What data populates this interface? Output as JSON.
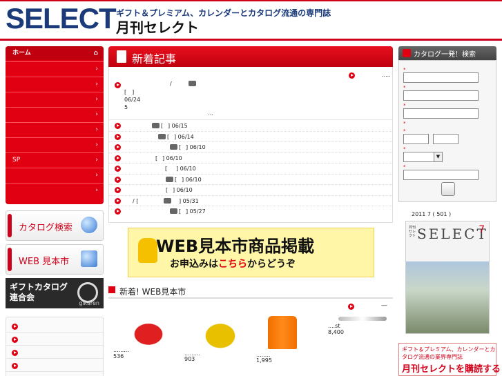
{
  "header": {
    "logo": "SELECT",
    "tagline": "ギフト＆プレミアム、カレンダーとカタログ流通の専門誌",
    "subtitle": "月刊セレクト"
  },
  "nav": {
    "home": "ホーム",
    "sp_label": "SP",
    "chevron": "›"
  },
  "side_banners": {
    "catalog_search": "カタログ検索",
    "web_market": "WEB 見本市",
    "gikaren_title": "ギフトカタログ 連合会",
    "gikaren_sub": "gikaren"
  },
  "news": {
    "title": "新着記事",
    "featured": {
      "slash": "/",
      "bracket": "[　]",
      "date": "06/24",
      "number": "5",
      "more": "…",
      "dots": "....."
    },
    "items": [
      {
        "bracket": "[",
        "date": "] 06/15"
      },
      {
        "bracket": "[",
        "date": "] 06/14"
      },
      {
        "bracket": "[",
        "date": "] 06/10"
      },
      {
        "bracket": "[",
        "date": "] 06/10"
      },
      {
        "bracket": "[",
        "date": "] 06/10"
      },
      {
        "bracket": "[",
        "date": "] 06/10"
      },
      {
        "bracket": "[",
        "date": "] 06/10"
      },
      {
        "bracket": "/   [",
        "date": "] 05/31"
      },
      {
        "bracket": "[",
        "date": "] 05/27"
      }
    ]
  },
  "web_banner": {
    "line1": "WEB見本市商品掲載",
    "line2_pre": "お申込みは",
    "line2_red": "こちら",
    "line2_post": "からどうぞ"
  },
  "web_new": {
    "title": "新着! WEB見本市",
    "products": [
      {
        "price": "536",
        "dots": "........."
      },
      {
        "price": "903",
        "dots": "........."
      },
      {
        "price": "1,995",
        "dots": "........"
      },
      {
        "price": "8,400",
        "dots": "....st"
      }
    ],
    "dash": "—"
  },
  "search": {
    "title": "カタログ一発！検索",
    "required": "*",
    "submit_label": ""
  },
  "magazine": {
    "issue": "2011 7 ( 501 )",
    "cover_title": "SELECT",
    "cover_number": "7",
    "cover_small": "月刊 セレクト"
  },
  "subscribe": {
    "line1": "ギフト＆プレミアム、カレンダーとカタログ流通の業界専門誌",
    "line2": "月刊セレクトを購読する"
  },
  "colors": {
    "brand_red": "#e00012",
    "brand_navy": "#1a3a7a"
  }
}
